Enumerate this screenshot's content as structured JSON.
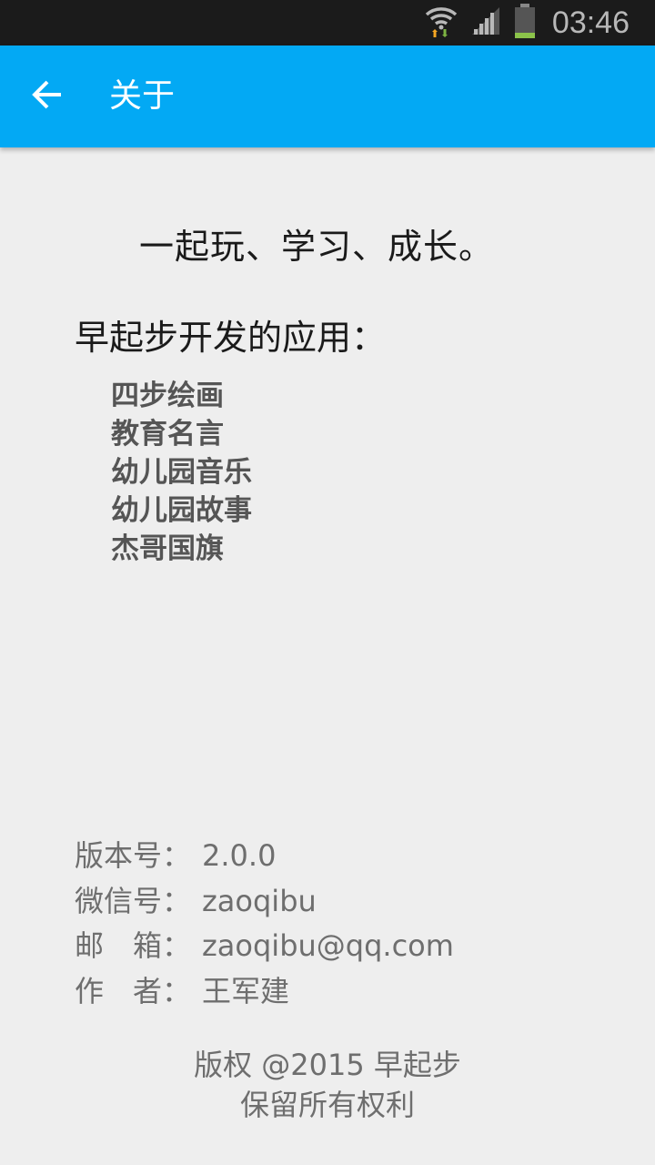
{
  "status_bar": {
    "time": "03:46",
    "icons": [
      "wifi-icon",
      "signal-icon",
      "battery-icon"
    ],
    "battery_color": "#8bc34a"
  },
  "app_bar": {
    "title": "关于",
    "back_icon": "arrow-back-icon",
    "color": "#03a9f4"
  },
  "main": {
    "slogan": "一起玩、学习、成长。",
    "apps_heading": "早起步开发的应用：",
    "apps": [
      "四步绘画",
      "教育名言",
      "幼儿园音乐",
      "幼儿园故事",
      "杰哥国旗"
    ]
  },
  "info": {
    "version_label": "版本号：",
    "version_value": "2.0.0",
    "wechat_label": "微信号：",
    "wechat_value": "zaoqibu",
    "email_label": "邮　箱：",
    "email_value": "zaoqibu@qq.com",
    "author_label": "作　者：",
    "author_value": "王军建"
  },
  "footer": {
    "copyright": "版权 @2015 早起步",
    "rights": "保留所有权利"
  }
}
